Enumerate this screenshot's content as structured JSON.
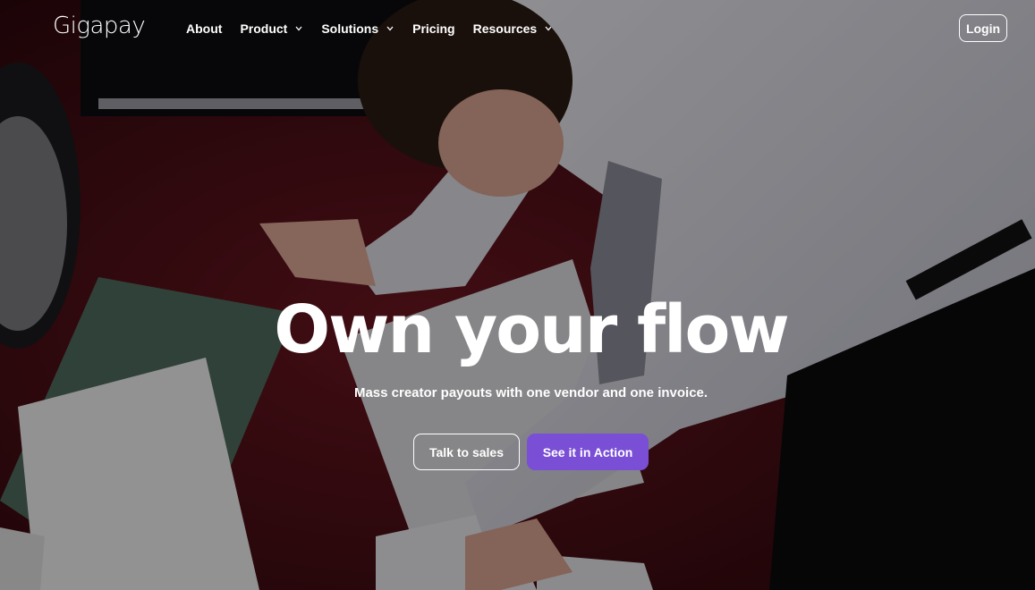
{
  "brand": {
    "logo_text": "Gigapay"
  },
  "nav": {
    "items": [
      {
        "label": "About",
        "has_dropdown": false
      },
      {
        "label": "Product",
        "has_dropdown": true
      },
      {
        "label": "Solutions",
        "has_dropdown": true
      },
      {
        "label": "Pricing",
        "has_dropdown": false
      },
      {
        "label": "Resources",
        "has_dropdown": true
      }
    ],
    "login_label": "Login"
  },
  "hero": {
    "headline": "Own your flow",
    "subheadline": "Mass creator payouts with one vendor and one invoice.",
    "secondary_cta": "Talk to sales",
    "primary_cta": "See it in Action"
  },
  "colors": {
    "accent": "#7a4fd6",
    "background": "#4a0f14",
    "text": "#ffffff"
  }
}
